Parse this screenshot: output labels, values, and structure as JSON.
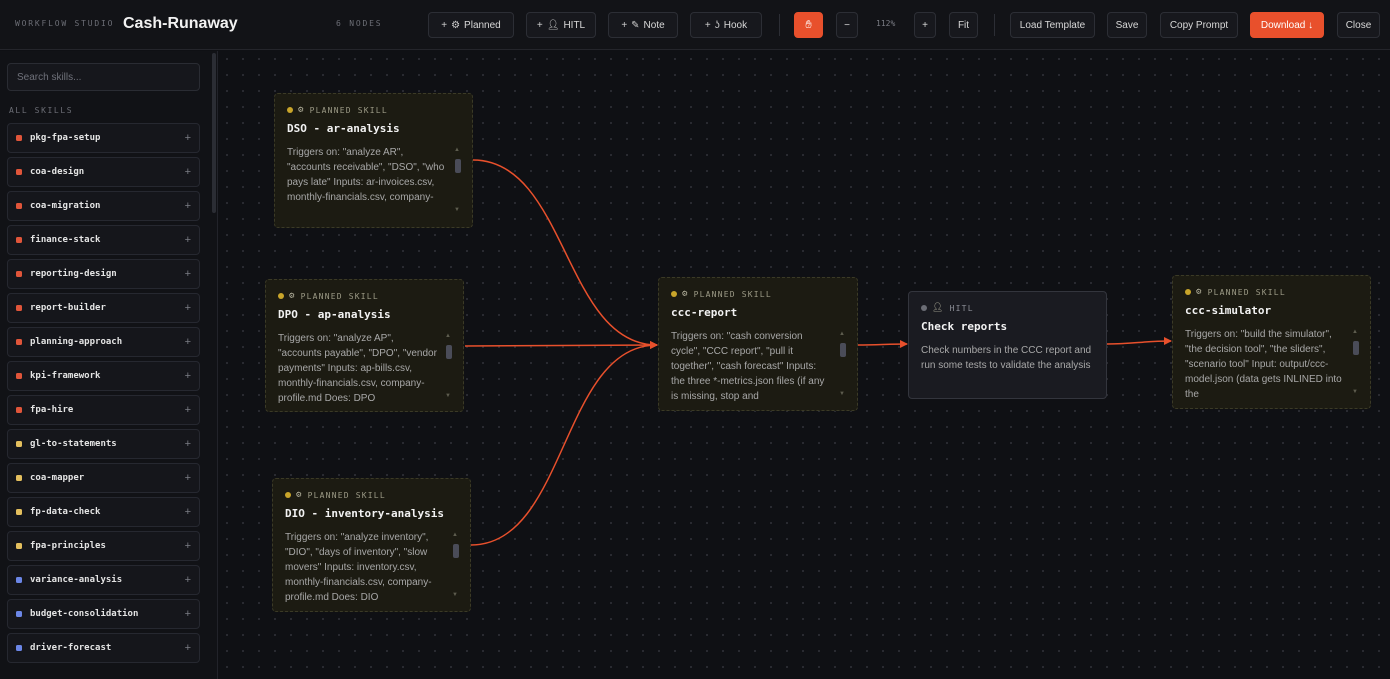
{
  "header": {
    "brand": "WORKFLOW STUDIO",
    "title": "Cash-Runaway",
    "node_count": "6 NODES",
    "add_planned": "Planned",
    "add_hitl": "HITL",
    "add_note": "Note",
    "add_hook": "Hook",
    "zoom_out": "−",
    "zoom_level": "112%",
    "zoom_in": "+",
    "fit": "Fit",
    "load_template": "Load Template",
    "save": "Save",
    "copy_prompt": "Copy Prompt",
    "download": "Download ↓",
    "close": "Close",
    "accent_color": "#e8502c"
  },
  "sidebar": {
    "search_placeholder": "Search skills...",
    "section_label": "ALL SKILLS",
    "skills": [
      {
        "name": "pkg-fpa-setup",
        "color": "#e0553a"
      },
      {
        "name": "coa-design",
        "color": "#e0553a"
      },
      {
        "name": "coa-migration",
        "color": "#e0553a"
      },
      {
        "name": "finance-stack",
        "color": "#e0553a"
      },
      {
        "name": "reporting-design",
        "color": "#e0553a"
      },
      {
        "name": "report-builder",
        "color": "#e0553a"
      },
      {
        "name": "planning-approach",
        "color": "#e0553a"
      },
      {
        "name": "kpi-framework",
        "color": "#e0553a"
      },
      {
        "name": "fpa-hire",
        "color": "#e0553a"
      },
      {
        "name": "gl-to-statements",
        "color": "#e3bf5e"
      },
      {
        "name": "coa-mapper",
        "color": "#e3bf5e"
      },
      {
        "name": "fp-data-check",
        "color": "#e3bf5e"
      },
      {
        "name": "fpa-principles",
        "color": "#e3bf5e"
      },
      {
        "name": "variance-analysis",
        "color": "#6b86e6"
      },
      {
        "name": "budget-consolidation",
        "color": "#6b86e6"
      },
      {
        "name": "driver-forecast",
        "color": "#6b86e6"
      }
    ]
  },
  "nodes": {
    "dso": {
      "badge": "PLANNED SKILL",
      "title": "DSO - ar-analysis",
      "body": "Triggers on: \"analyze AR\", \"accounts receivable\", \"DSO\", \"who pays late\" Inputs: ar-invoices.csv, monthly-financials.csv, company-"
    },
    "dpo": {
      "badge": "PLANNED SKILL",
      "title": "DPO - ap-analysis",
      "body": "Triggers on: \"analyze AP\", \"accounts payable\", \"DPO\", \"vendor payments\" Inputs: ap-bills.csv, monthly-financials.csv, company-profile.md Does: DPO"
    },
    "dio": {
      "badge": "PLANNED SKILL",
      "title": "DIO - inventory-analysis",
      "body": "Triggers on: \"analyze inventory\", \"DIO\", \"days of inventory\", \"slow movers\" Inputs: inventory.csv, monthly-financials.csv, company-profile.md Does: DIO"
    },
    "ccc_report": {
      "badge": "PLANNED SKILL",
      "title": "ccc-report",
      "body": "Triggers on: \"cash conversion cycle\", \"CCC report\", \"pull it together\", \"cash forecast\" Inputs: the three *-metrics.json files (if any is missing, stop and"
    },
    "check_reports": {
      "badge": "HITL",
      "title": "Check reports",
      "body": "Check numbers in the CCC report and run some tests to validate the analysis"
    },
    "ccc_simulator": {
      "badge": "PLANNED SKILL",
      "title": "ccc-simulator",
      "body": "Triggers on: \"build the simulator\", \"the decision tool\", \"the sliders\", \"scenario tool\" Input: output/ccc-model.json (data gets INLINED into the"
    }
  }
}
